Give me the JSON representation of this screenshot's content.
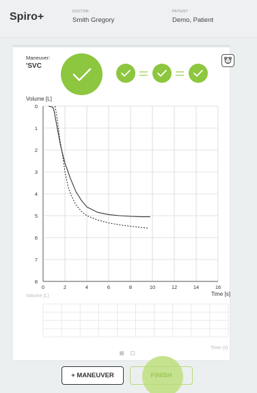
{
  "app": {
    "title": "Spiro+"
  },
  "header": {
    "doctor_key": "DOCTOR",
    "doctor_name": "Smith Gregory",
    "patient_key": "PATIENT",
    "patient_name": "Demo, Patient"
  },
  "maneuver": {
    "key": "Maneuver:",
    "value": "'SVC"
  },
  "colors": {
    "accent": "#8dc63f",
    "accent_light": "#bfe08f"
  },
  "icons": {
    "settings": "baby-face-icon",
    "check": "check-icon"
  },
  "chart_data": {
    "type": "line",
    "ylabel": "Volume [L]",
    "xlabel": "Time [s]",
    "xlim": [
      0,
      16
    ],
    "ylim": [
      0,
      8
    ],
    "y_inverted": true,
    "grid": true,
    "x_ticks": [
      "0",
      "2",
      "4",
      "6",
      "8",
      "10",
      "12",
      "14",
      "16"
    ],
    "y_ticks": [
      "0",
      "1",
      "2",
      "3",
      "4",
      "5",
      "6",
      "7",
      "8"
    ],
    "series": [
      {
        "style": "solid",
        "x": [
          0.5,
          0.9,
          1.0,
          1.3,
          1.6,
          2.0,
          2.5,
          3.0,
          3.5,
          4.0,
          5.0,
          6.0,
          7.0,
          8.0,
          9.0,
          9.8
        ],
        "y": [
          0,
          0.05,
          0.2,
          1.0,
          1.8,
          2.6,
          3.3,
          3.9,
          4.3,
          4.6,
          4.85,
          4.95,
          5.0,
          5.03,
          5.05,
          5.05
        ]
      },
      {
        "style": "dashed",
        "x": [
          1.1,
          1.3,
          1.5,
          1.8,
          2.0,
          2.3,
          2.6,
          3.0,
          3.5,
          4.0,
          5.0,
          6.0,
          7.0,
          8.0,
          9.0,
          9.6
        ],
        "y": [
          0,
          0.6,
          1.4,
          2.3,
          3.0,
          3.7,
          4.1,
          4.5,
          4.8,
          5.0,
          5.2,
          5.33,
          5.42,
          5.48,
          5.54,
          5.57
        ]
      }
    ]
  },
  "ghost": {
    "volume_label": "Volume (L)",
    "time_label": "Time (s)"
  },
  "buttons": {
    "add_maneuver": "+ MANEUVER",
    "finish": "FINISH"
  }
}
